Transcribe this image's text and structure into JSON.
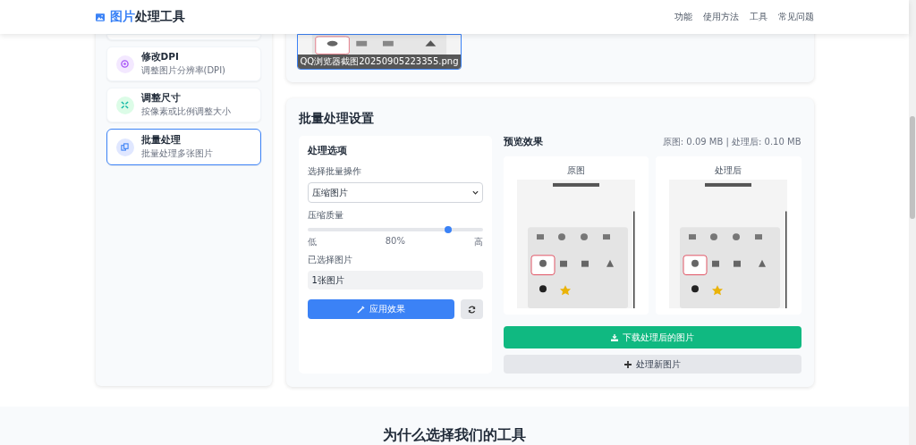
{
  "header": {
    "title_highlight": "图片",
    "title_rest": "处理工具",
    "nav": [
      "功能",
      "使用方法",
      "工具",
      "常见问题"
    ]
  },
  "sidebar": {
    "items": [
      {
        "kind": "dpi",
        "title": "修改DPI",
        "subtitle": "调整图片分辨率(DPI)",
        "selected": false
      },
      {
        "kind": "resize",
        "title": "调整尺寸",
        "subtitle": "按像素或比例调整大小",
        "selected": false
      },
      {
        "kind": "batch",
        "title": "批量处理",
        "subtitle": "批量处理多张图片",
        "selected": true
      }
    ]
  },
  "upload": {
    "filename": "QQ浏览器截图20250905223355.png",
    "selected": true
  },
  "batch": {
    "title": "批量处理设置",
    "options": {
      "heading": "处理选项",
      "operation_label": "选择批量操作",
      "operation_value": "压缩图片",
      "quality_label": "压缩质量",
      "quality": {
        "level": 0.8,
        "min_label": "低",
        "reading": "80%",
        "max_label": "高"
      },
      "selected_label": "已选择图片",
      "selected_value": "1张图片",
      "apply_button": "应用效果"
    },
    "preview": {
      "heading": "预览效果",
      "sizes": "原图: 0.09 MB | 处理后: 0.10 MB",
      "panes": [
        {
          "label": "原图"
        },
        {
          "label": "处理后"
        }
      ],
      "download_button": "下载处理后的图片",
      "new_button": "处理新图片"
    }
  },
  "section": {
    "heading": "为什么选择我们的工具"
  }
}
